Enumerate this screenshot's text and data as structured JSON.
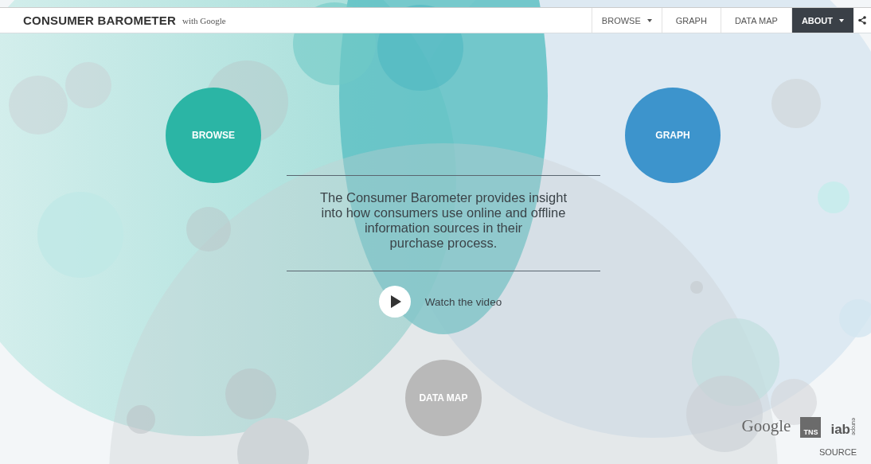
{
  "header": {
    "brand": "CONSUMER BAROMETER",
    "brand_suffix": "with Google"
  },
  "nav": [
    {
      "label": "BROWSE",
      "dropdown": true,
      "selected": false
    },
    {
      "label": "GRAPH",
      "dropdown": false,
      "selected": false
    },
    {
      "label": "DATA MAP",
      "dropdown": false,
      "selected": false
    },
    {
      "label": "ABOUT",
      "dropdown": true,
      "selected": true
    }
  ],
  "hubs": [
    {
      "label": "BROWSE",
      "color": "#2bb5a5"
    },
    {
      "label": "GRAPH",
      "color": "#3d94cc"
    },
    {
      "label": "DATA MAP",
      "color": "#b9b9b9"
    }
  ],
  "intro": [
    "The Consumer Barometer provides insight",
    "into how consumers use online and offline",
    "information sources in their",
    "purchase process."
  ],
  "video_link": "Watch the video",
  "partners": {
    "google": "Google",
    "tns": "TNS",
    "iab": "iab",
    "iab_sub": "europe",
    "source": "SOURCE"
  }
}
